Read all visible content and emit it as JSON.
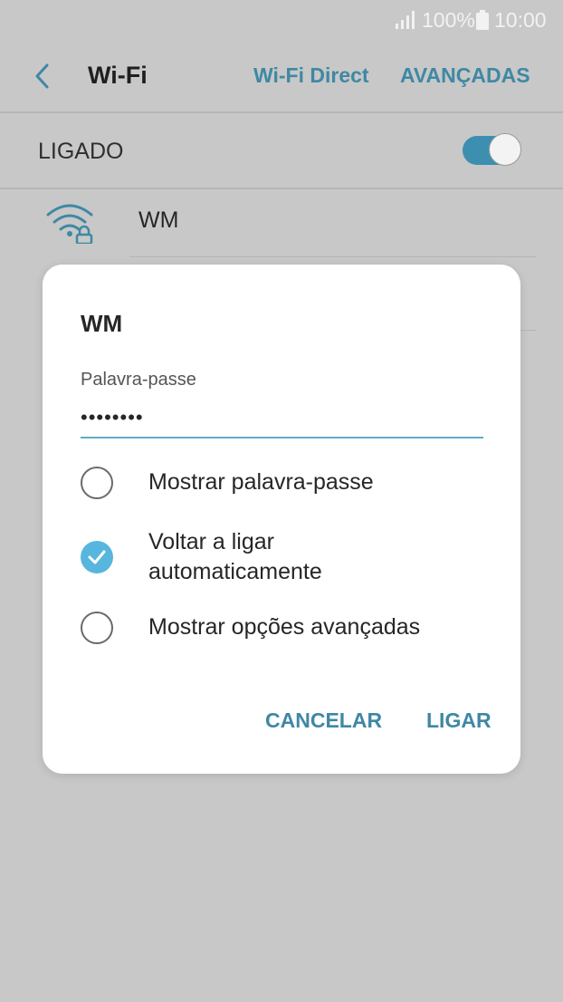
{
  "status_bar": {
    "battery_percent": "100%",
    "time": "10:00",
    "signal_icon": "signal-bars-icon",
    "battery_icon": "battery-icon"
  },
  "app_bar": {
    "back_icon": "chevron-left-icon",
    "title": "Wi-Fi",
    "wifi_direct_label": "Wi-Fi Direct",
    "advanced_label": "AVANÇADAS"
  },
  "wifi_toggle": {
    "label": "LIGADO",
    "on": true
  },
  "network": {
    "name": "WM",
    "icon": "wifi-lock-icon"
  },
  "dialog": {
    "title": "WM",
    "password_label": "Palavra-passe",
    "password_value": "••••••••",
    "options": [
      {
        "label": "Mostrar palavra-passe",
        "checked": false
      },
      {
        "label_line1": "Voltar a ligar",
        "label_line2": "automaticamente",
        "checked": true
      },
      {
        "label": "Mostrar opções avançadas",
        "checked": false
      }
    ],
    "cancel_label": "CANCELAR",
    "connect_label": "LIGAR"
  },
  "colors": {
    "accent": "#3f88a4",
    "checkbox_active": "#57b6de",
    "background_dim": "#c8c8c8"
  }
}
